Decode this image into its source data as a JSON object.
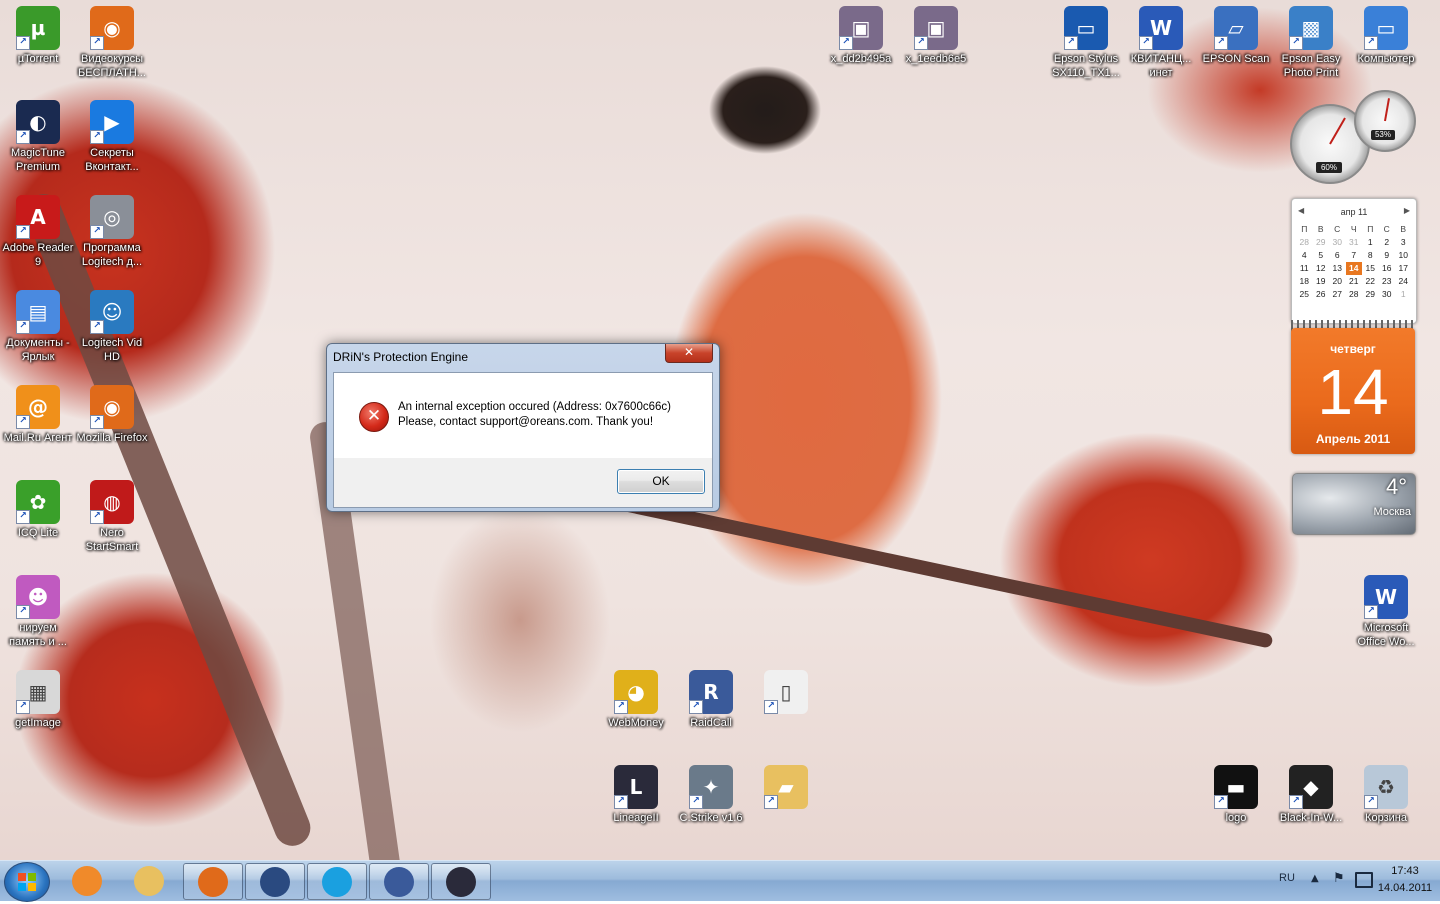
{
  "desktop_icons_left": [
    {
      "label": "µTorrent",
      "icon": "utorrent-icon"
    },
    {
      "label": "Видеокурсы БЕСПЛАТН...",
      "icon": "firefox-document-icon"
    },
    {
      "label": "MagicTune Premium",
      "icon": "magictune-icon"
    },
    {
      "label": "Секреты Вконтакт...",
      "icon": "play-icon"
    },
    {
      "label": "Adobe Reader 9",
      "icon": "adobe-reader-icon"
    },
    {
      "label": "Программа Logitech д...",
      "icon": "webcam-icon"
    },
    {
      "label": "Документы - Ярлык",
      "icon": "documents-icon"
    },
    {
      "label": "Logitech Vid HD",
      "icon": "logitech-vid-icon"
    },
    {
      "label": "Mail.Ru Агент",
      "icon": "mailru-agent-icon"
    },
    {
      "label": "Mozilla Firefox",
      "icon": "firefox-icon"
    },
    {
      "label": "ICQ Lite",
      "icon": "icq-icon"
    },
    {
      "label": "Nero StartSmart",
      "icon": "nero-icon"
    },
    {
      "label": "нируем память и ...",
      "icon": "cartoon-icon"
    },
    {
      "label": "getImage",
      "icon": "getimage-icon"
    }
  ],
  "desktop_icons_top": [
    {
      "label": "x_dd2b495a",
      "icon": "image-file-icon"
    },
    {
      "label": "x_1eedb6e5",
      "icon": "image-file-icon"
    },
    {
      "label": "Epson Stylus SX110_TX1...",
      "icon": "epson-printer-icon"
    },
    {
      "label": "КВИТАНЦ... инет",
      "icon": "word-document-icon"
    },
    {
      "label": "EPSON Scan",
      "icon": "epson-scan-icon"
    },
    {
      "label": "Epson Easy Photo Print",
      "icon": "epson-photo-icon"
    },
    {
      "label": "Компьютер",
      "icon": "computer-icon"
    }
  ],
  "desktop_icons_bottom": [
    {
      "label": "WebMoney",
      "icon": "webmoney-icon"
    },
    {
      "label": "RaidCall",
      "icon": "raidcall-icon"
    },
    {
      "label": "",
      "icon": "blank-file-icon"
    },
    {
      "label": "LineageII",
      "icon": "lineage-icon"
    },
    {
      "label": "C.Strike v1.6",
      "icon": "counter-strike-icon"
    },
    {
      "label": "",
      "icon": "folder-icon"
    },
    {
      "label": "logo",
      "icon": "logo-image-icon"
    },
    {
      "label": "Black-In-W...",
      "icon": "black-image-icon"
    },
    {
      "label": "Корзина",
      "icon": "recycle-bin-icon"
    },
    {
      "label": "Microsoft Office Wo...",
      "icon": "word-icon"
    }
  ],
  "dialog": {
    "title": "DRiN's Protection Engine",
    "close_glyph": "✕",
    "message_line1": "An internal exception occured (Address: 0x7600c66c)",
    "message_line2": "Please, contact support@oreans.com. Thank you!",
    "ok_label": "OK"
  },
  "gadgets": {
    "cpu_percent": "60%",
    "memory_percent": "53%",
    "calendar": {
      "month_label": "апр 11",
      "weekdays": [
        "П",
        "В",
        "С",
        "Ч",
        "П",
        "С",
        "В"
      ],
      "weeks": [
        [
          "28",
          "29",
          "30",
          "31",
          "1",
          "2",
          "3"
        ],
        [
          "4",
          "5",
          "6",
          "7",
          "8",
          "9",
          "10"
        ],
        [
          "11",
          "12",
          "13",
          "14",
          "15",
          "16",
          "17"
        ],
        [
          "18",
          "19",
          "20",
          "21",
          "22",
          "23",
          "24"
        ],
        [
          "25",
          "26",
          "27",
          "28",
          "29",
          "30",
          "1"
        ]
      ],
      "today": "14",
      "weekday_name": "четверг",
      "day_number": "14",
      "month_year": "Апрель 2011"
    },
    "weather": {
      "temperature": "4°",
      "city": "Москва"
    }
  },
  "taskbar": {
    "buttons": [
      {
        "name": "media-player",
        "icon": "media-player-icon",
        "open": false,
        "color": "#f08a2a"
      },
      {
        "name": "explorer",
        "icon": "explorer-icon",
        "open": false,
        "color": "#e8c060"
      },
      {
        "name": "firefox",
        "icon": "firefox-icon",
        "open": true,
        "color": "#e06a1a"
      },
      {
        "name": "magictune",
        "icon": "magictune-icon",
        "open": true,
        "color": "#2a4a80"
      },
      {
        "name": "skype",
        "icon": "skype-icon",
        "open": true,
        "color": "#1aa0e0"
      },
      {
        "name": "raidcall",
        "icon": "raidcall-icon",
        "open": true,
        "color": "#3a5a9a"
      },
      {
        "name": "lineage",
        "icon": "lineage-icon",
        "open": true,
        "color": "#2a2a3a"
      }
    ],
    "language": "RU",
    "time": "17:43",
    "date": "14.04.2011"
  },
  "colors": {
    "error_red": "#d42a1a",
    "today_orange": "#e87720",
    "taskbar_blue": "#9dbbdc"
  }
}
